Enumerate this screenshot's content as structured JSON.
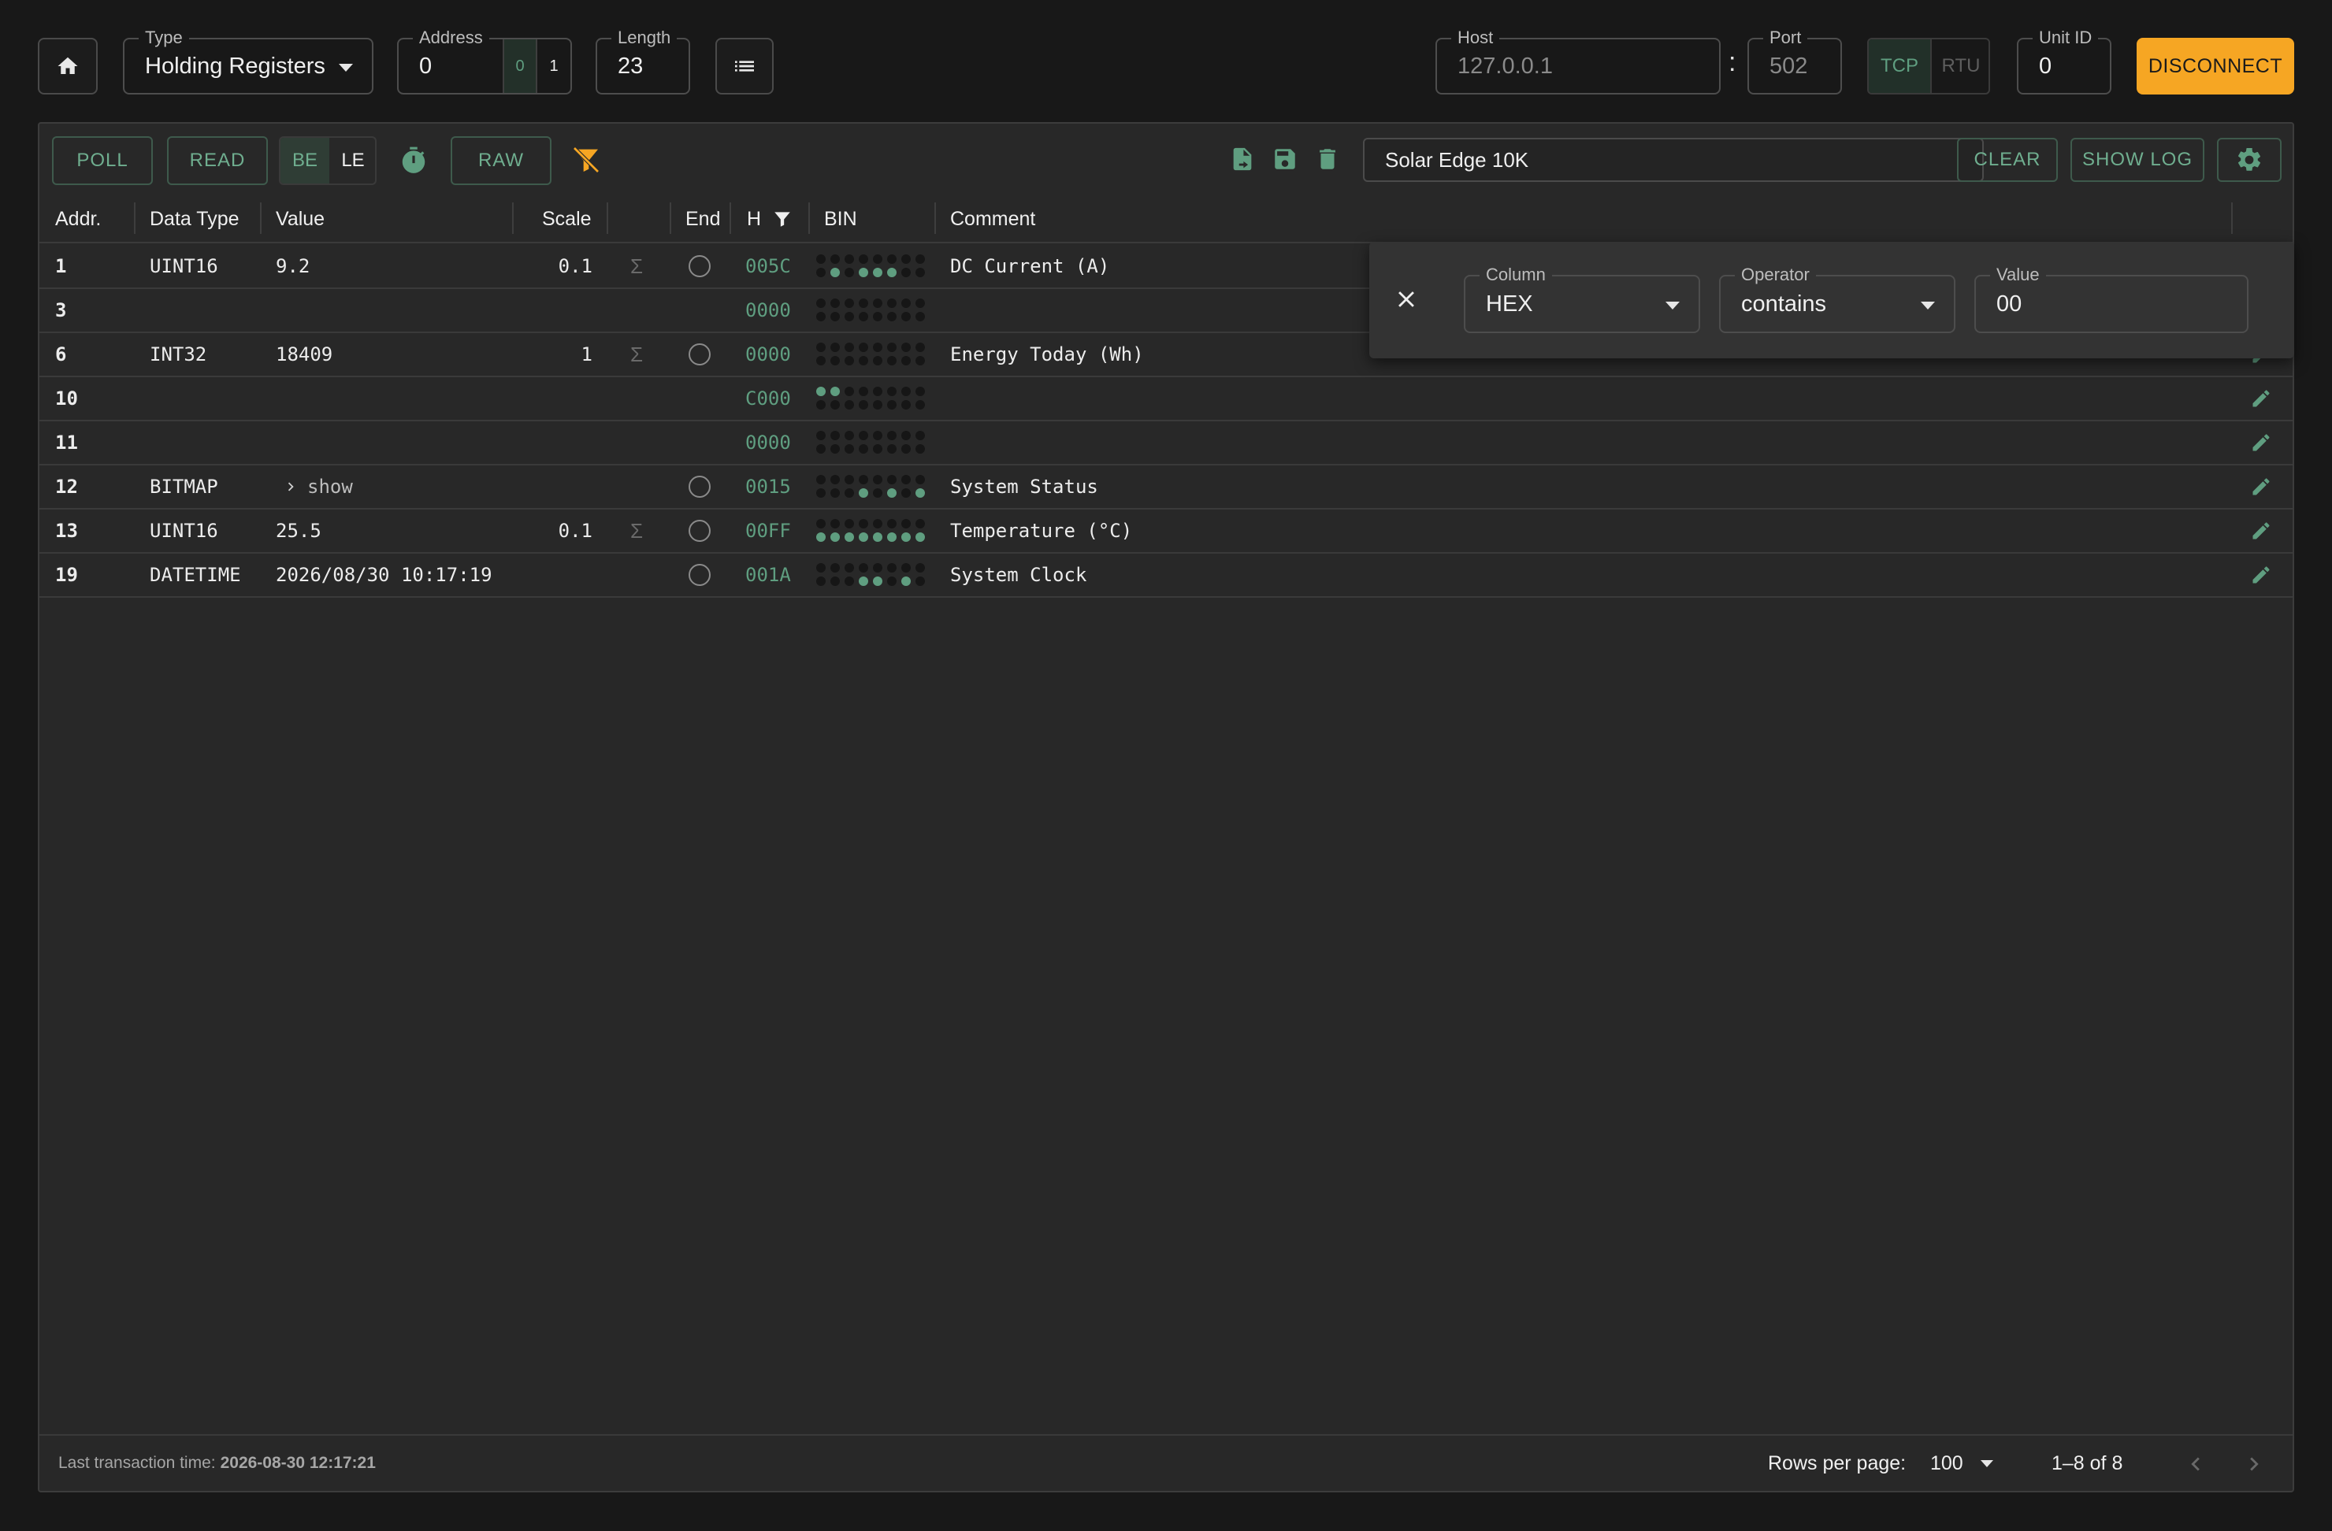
{
  "toolbar": {
    "type": {
      "label": "Type",
      "value": "Holding Registers"
    },
    "address": {
      "label": "Address",
      "value": "0",
      "base_options": [
        "0",
        "1"
      ]
    },
    "length": {
      "label": "Length",
      "value": "23"
    },
    "host": {
      "label": "Host",
      "value": "127.0.0.1"
    },
    "port_separator": ":",
    "port": {
      "label": "Port",
      "value": "502"
    },
    "protocol": {
      "options": [
        "TCP",
        "RTU"
      ],
      "selected": "TCP"
    },
    "unit_id": {
      "label": "Unit ID",
      "value": "0"
    },
    "disconnect_label": "DISCONNECT"
  },
  "actions": {
    "poll": "POLL",
    "read": "READ",
    "endian": {
      "options": [
        "BE",
        "LE"
      ],
      "selected": "BE"
    },
    "raw": "RAW",
    "config_name": "Solar Edge 10K",
    "clear": "CLEAR",
    "show_log": "SHOW LOG"
  },
  "table": {
    "headers": {
      "addr": "Addr.",
      "data_type": "Data Type",
      "value": "Value",
      "scale": "Scale",
      "end": "End",
      "hex": "H",
      "bin": "BIN",
      "comment": "Comment"
    },
    "rows": [
      {
        "addr": "1",
        "type": "UINT16",
        "value": "9.2",
        "scale": "0.1",
        "sigma": true,
        "end": true,
        "hex": "005C",
        "bin": "0000000001011100",
        "comment": "DC Current (A)"
      },
      {
        "addr": "3",
        "type": "",
        "value": "",
        "scale": "",
        "sigma": false,
        "end": false,
        "hex": "0000",
        "bin": "0000000000000000",
        "comment": ""
      },
      {
        "addr": "6",
        "type": "INT32",
        "value": "18409",
        "scale": "1",
        "sigma": true,
        "end": true,
        "hex": "0000",
        "bin": "0000000000000000",
        "comment": "Energy Today (Wh)"
      },
      {
        "addr": "10",
        "type": "",
        "value": "",
        "scale": "",
        "sigma": false,
        "end": false,
        "hex": "C000",
        "bin": "1100000000000000",
        "comment": ""
      },
      {
        "addr": "11",
        "type": "",
        "value": "",
        "scale": "",
        "sigma": false,
        "end": false,
        "hex": "0000",
        "bin": "0000000000000000",
        "comment": ""
      },
      {
        "addr": "12",
        "type": "BITMAP",
        "value": "show",
        "expandable": true,
        "scale": "",
        "sigma": false,
        "end": true,
        "hex": "0015",
        "bin": "0000000000010101",
        "comment": "System Status"
      },
      {
        "addr": "13",
        "type": "UINT16",
        "value": "25.5",
        "scale": "0.1",
        "sigma": true,
        "end": true,
        "hex": "00FF",
        "bin": "0000000011111111",
        "comment": "Temperature (°C)"
      },
      {
        "addr": "19",
        "type": "DATETIME",
        "value": "2026/08/30 10:17:19",
        "scale": "",
        "sigma": false,
        "end": true,
        "hex": "001A",
        "bin": "0000000000011010",
        "comment": "System Clock"
      }
    ]
  },
  "filter": {
    "column": {
      "label": "Column",
      "value": "HEX"
    },
    "operator": {
      "label": "Operator",
      "value": "contains"
    },
    "value": {
      "label": "Value",
      "value": "00"
    }
  },
  "footer": {
    "last_tx_label": "Last transaction time:",
    "last_tx_value": "2026-08-30 12:17:21",
    "rows_per_page_label": "Rows per page:",
    "rows_per_page": "100",
    "range": "1–8 of 8"
  },
  "colors": {
    "accent": "#5f9e80",
    "warning": "#f6a623",
    "background": "#181818",
    "panel": "#282828"
  },
  "icons": [
    "home-icon",
    "list-icon",
    "timer-icon",
    "filter-off-icon",
    "file-export-icon",
    "save-icon",
    "delete-icon",
    "gear-icon",
    "filter-icon",
    "sigma-icon",
    "pencil-icon",
    "close-icon",
    "chevron-right-icon",
    "chevron-left-icon"
  ]
}
